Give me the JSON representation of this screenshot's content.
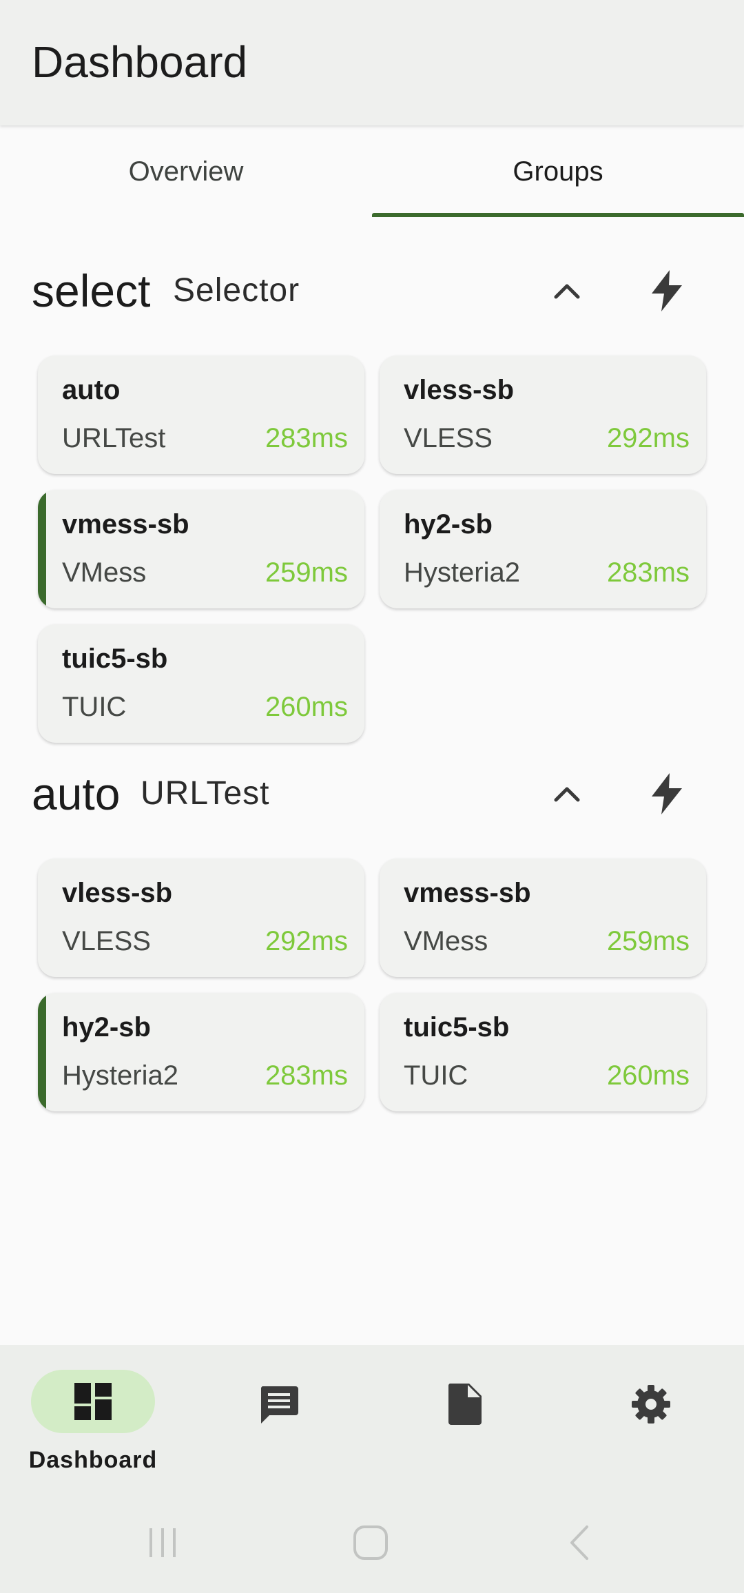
{
  "app_bar": {
    "title": "Dashboard"
  },
  "tabs": [
    {
      "label": "Overview",
      "selected": false
    },
    {
      "label": "Groups",
      "selected": true
    }
  ],
  "groups": [
    {
      "name": "select",
      "type": "Selector",
      "collapse_icon": "chevron-up-icon",
      "test_icon": "lightning-bolt-icon",
      "proxies": [
        {
          "name": "auto",
          "type": "URLTest",
          "delay": "283ms",
          "selected": false
        },
        {
          "name": "vless-sb",
          "type": "VLESS",
          "delay": "292ms",
          "selected": false
        },
        {
          "name": "vmess-sb",
          "type": "VMess",
          "delay": "259ms",
          "selected": true
        },
        {
          "name": "hy2-sb",
          "type": "Hysteria2",
          "delay": "283ms",
          "selected": false
        },
        {
          "name": "tuic5-sb",
          "type": "TUIC",
          "delay": "260ms",
          "selected": false
        }
      ]
    },
    {
      "name": "auto",
      "type": "URLTest",
      "collapse_icon": "chevron-up-icon",
      "test_icon": "lightning-bolt-icon",
      "proxies": [
        {
          "name": "vless-sb",
          "type": "VLESS",
          "delay": "292ms",
          "selected": false
        },
        {
          "name": "vmess-sb",
          "type": "VMess",
          "delay": "259ms",
          "selected": false
        },
        {
          "name": "hy2-sb",
          "type": "Hysteria2",
          "delay": "283ms",
          "selected": true
        },
        {
          "name": "tuic5-sb",
          "type": "TUIC",
          "delay": "260ms",
          "selected": false
        }
      ]
    }
  ],
  "bottom_nav": [
    {
      "label": "Dashboard",
      "icon": "dashboard-icon",
      "active": true
    },
    {
      "label": "",
      "icon": "message-icon",
      "active": false
    },
    {
      "label": "",
      "icon": "document-icon",
      "active": false
    },
    {
      "label": "",
      "icon": "settings-icon",
      "active": false
    }
  ],
  "system_nav": [
    "recent-apps-icon",
    "home-icon",
    "back-icon"
  ],
  "colors": {
    "accent": "#3b6a2c",
    "delay_text": "#7ec93b",
    "active_nav_pill": "#d3ecc6",
    "card_bg": "#f1f2f0"
  }
}
